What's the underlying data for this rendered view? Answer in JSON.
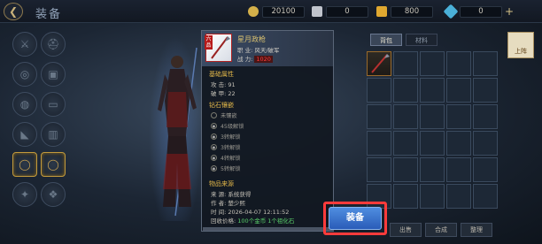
{
  "topbar": {
    "title": "装备",
    "currencies": [
      {
        "icon": "gold-coin-icon",
        "value": "20100",
        "color": "#d4b04a"
      },
      {
        "icon": "silver-ingot-icon",
        "value": "0",
        "color": "#c0c4cc"
      },
      {
        "icon": "gold-ingot-icon",
        "value": "800",
        "color": "#e0a830"
      },
      {
        "icon": "gem-icon",
        "value": "0",
        "color": "#4ab0d8"
      }
    ]
  },
  "tooltip": {
    "item_name": "星月政枪",
    "badge": "六品",
    "career_label": "职  业:",
    "career_value": "风天/破军",
    "power_label": "战  力:",
    "power_value": "1020",
    "base_attr_title": "基础属性",
    "attrs": [
      {
        "label": "攻  击:",
        "value": "91"
      },
      {
        "label": "破  甲:",
        "value": "22"
      }
    ],
    "gem_title": "钻石镶嵌",
    "gems": [
      "未镶嵌",
      "45级解锁",
      "3转解锁",
      "3转解锁",
      "4转解锁",
      "5转解锁"
    ],
    "source_title": "物品来源",
    "source_rows": [
      {
        "label": "来    源:",
        "value": "系统获得"
      },
      {
        "label": "作    者:",
        "value": "楚少熙"
      },
      {
        "label": "时    间:",
        "value": "2026-04-07 12:11:52"
      }
    ],
    "recycle_label": "回收价格:",
    "recycle_value": "100个金币 1个祖化石"
  },
  "equip_button": "装备",
  "inventory": {
    "tabs": [
      "背包",
      "材料"
    ],
    "active_tab": 0,
    "side_tab": "上阵",
    "buttons": [
      "出售",
      "合成",
      "整理"
    ]
  }
}
